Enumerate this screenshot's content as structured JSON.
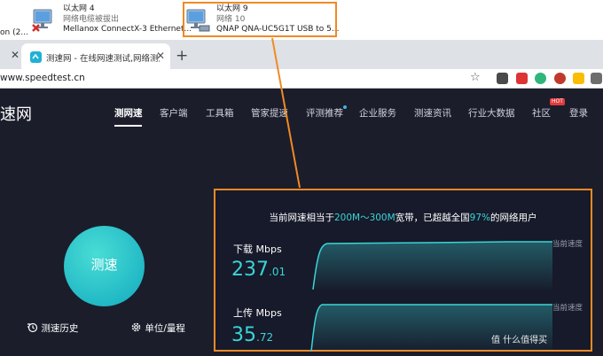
{
  "network": {
    "adapters": [
      {
        "fragment": "on (2..."
      },
      {
        "name": "以太网 4",
        "status": "网络电缆被拔出",
        "device": "Mellanox ConnectX-3 Ethernet..."
      },
      {
        "name": "以太网 9",
        "status": "网络 10",
        "device": "QNAP QNA-UC5G1T USB to 5..."
      }
    ]
  },
  "browser": {
    "tab": {
      "title": "测速网 - 在线网速测试,网络测速"
    },
    "url": "www.speedtest.cn"
  },
  "site": {
    "logo_fragment": "速网",
    "nav": [
      {
        "label": "测网速"
      },
      {
        "label": "客户端"
      },
      {
        "label": "工具箱"
      },
      {
        "label": "管家提速"
      },
      {
        "label": "评测推荐"
      },
      {
        "label": "企业服务"
      },
      {
        "label": "测速资讯"
      },
      {
        "label": "行业大数据"
      },
      {
        "label": "社区"
      },
      {
        "label": "登录"
      }
    ],
    "hot_badge": "HOT"
  },
  "main": {
    "test_button": "测速",
    "history_link": "测速历史",
    "unit_link": "单位/量程",
    "headline": {
      "pre": "当前网速相当于",
      "range": "200M～300M",
      "mid": "宽带，已超越全国",
      "percent": "97%",
      "post": "的网络用户"
    },
    "download": {
      "label": "下载 Mbps",
      "value_int": "237",
      "value_dec": ".01",
      "value": 237.01,
      "current_label": "当前速度"
    },
    "upload": {
      "label": "上传 Mbps",
      "value_int": "35",
      "value_dec": ".72",
      "value": 35.72,
      "current_label": "当前速度"
    }
  },
  "watermark": "值 什么值得买",
  "colors": {
    "accent": "#3bd4d6",
    "highlight_border": "#f08a24",
    "background": "#1b1d2b",
    "brand_circle": "#22b9c6"
  }
}
